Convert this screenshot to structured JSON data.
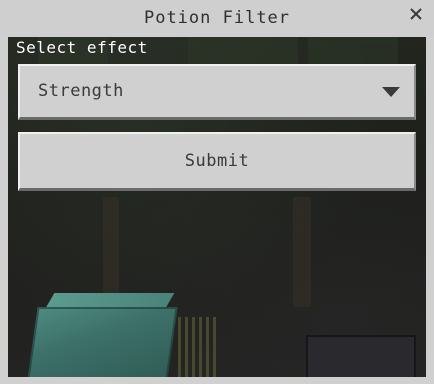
{
  "window": {
    "title": "Potion Filter",
    "close_icon": "close-icon"
  },
  "form": {
    "label": "Select effect",
    "dropdown": {
      "selected": "Strength",
      "icon": "chevron-down-icon"
    },
    "submit_label": "Submit"
  },
  "colors": {
    "panel_bg": "#d0d0d0",
    "button_face": "#d0d0d0",
    "text": "#3a3a3a",
    "label_text": "#ffffff"
  }
}
